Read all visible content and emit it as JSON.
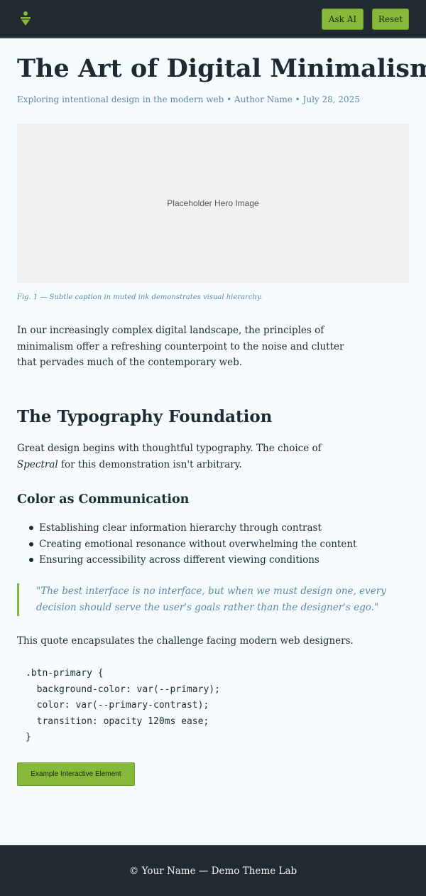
{
  "header": {
    "logo_icon": "leaf-pin-icon",
    "ask_ai_label": "Ask AI",
    "reset_label": "Reset",
    "accent_color": "#86b93a",
    "bar_color": "#222a31"
  },
  "article": {
    "title": "The Art of Digital Minimalism",
    "meta": "Exploring intentional design in the modern web • Author Name • July 28, 2025",
    "hero_placeholder": "Placeholder Hero Image",
    "caption": "Fig. 1 — Subtle caption in muted ink demonstrates visual hierarchy.",
    "intro": "In our increasingly complex digital landscape, the principles of minimalism offer a refreshing counterpoint to the noise and clutter that pervades much of the contemporary web.",
    "section_heading": "The Typography Foundation",
    "typography_text_before": "Great design begins with thoughtful typography. The choice of ",
    "typography_font_name": "Spectral",
    "typography_text_after": " for this demonstration isn't arbitrary.",
    "subheading": "Color as Communication",
    "list": [
      "Establishing clear information hierarchy through contrast",
      "Creating emotional resonance without overwhelming the content",
      "Ensuring accessibility across different viewing conditions"
    ],
    "quote": "\"The best interface is no interface, but when we must design one, every decision should serve the user's goals rather than the designer's ego.\"",
    "after_quote": "This quote encapsulates the challenge facing modern web designers.",
    "code": ".btn-primary {\n  background-color: var(--primary);\n  color: var(--primary-contrast);\n  transition: opacity 120ms ease;\n}",
    "cta_label": "Example Interactive Element"
  },
  "footer": {
    "text": "© Your Name — Demo Theme Lab"
  }
}
